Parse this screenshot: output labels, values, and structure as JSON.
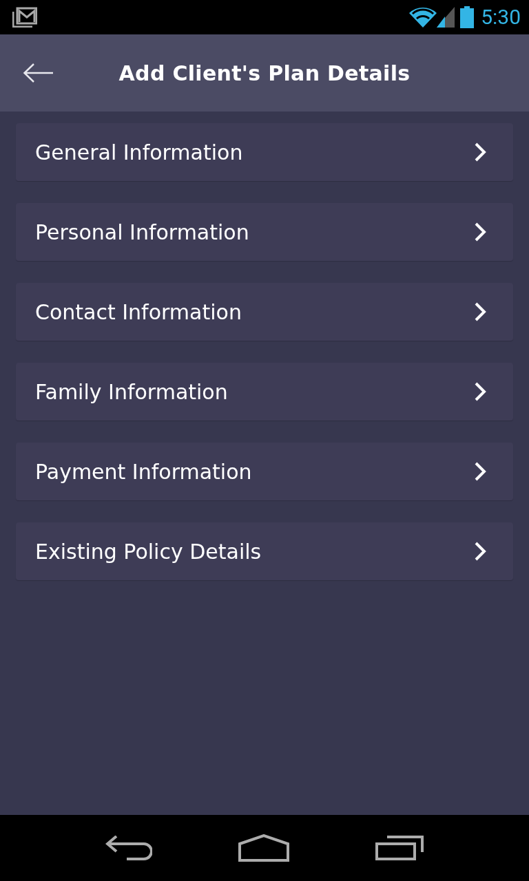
{
  "status_bar": {
    "time": "5:30"
  },
  "app_bar": {
    "title": "Add Client's Plan Details"
  },
  "sections": [
    {
      "label": "General Information"
    },
    {
      "label": "Personal Information"
    },
    {
      "label": "Contact Information"
    },
    {
      "label": "Family Information"
    },
    {
      "label": "Payment Information"
    },
    {
      "label": "Existing Policy Details"
    }
  ]
}
